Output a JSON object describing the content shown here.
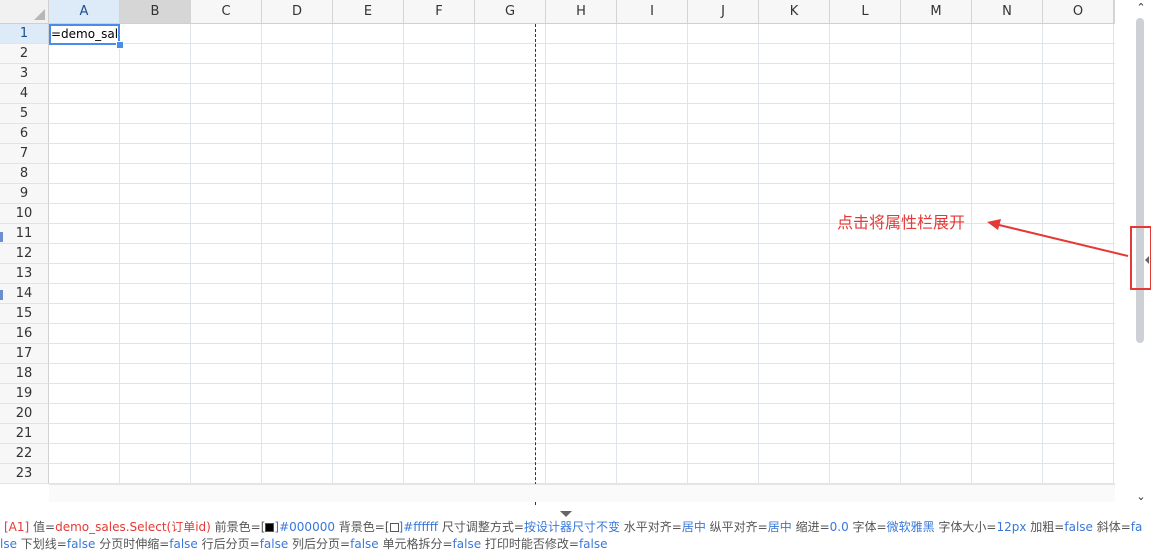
{
  "grid": {
    "columns": [
      "A",
      "B",
      "C",
      "D",
      "E",
      "F",
      "G",
      "H",
      "I",
      "J",
      "K",
      "L",
      "M",
      "N",
      "O"
    ],
    "rows": [
      "1",
      "2",
      "3",
      "4",
      "5",
      "6",
      "7",
      "8",
      "9",
      "10",
      "11",
      "12",
      "13",
      "14",
      "15",
      "16",
      "17",
      "18",
      "19",
      "20",
      "21",
      "22",
      "23"
    ],
    "active_cell": "A1",
    "cells": {
      "A1": "=demo_sale"
    }
  },
  "annotation": {
    "text": "点击将属性栏展开",
    "color": "#e53935"
  },
  "statusbar": {
    "line1": [
      {
        "text": "[A1] ",
        "cls": "s-red"
      },
      {
        "text": "值=",
        "cls": "s-gray"
      },
      {
        "text": "demo_sales.Select(订单id)",
        "cls": "s-red"
      },
      {
        "text": " 前景色=[",
        "cls": "s-gray"
      },
      {
        "swatch": "#000000"
      },
      {
        "text": "]#000000",
        "cls": "s-blue"
      },
      {
        "text": "  背景色=[",
        "cls": "s-gray"
      },
      {
        "swatch": "#ffffff"
      },
      {
        "text": "]#ffffff",
        "cls": "s-blue"
      },
      {
        "text": "  尺寸调整方式=",
        "cls": "s-gray"
      },
      {
        "text": "按设计器尺寸不变",
        "cls": "s-blue"
      },
      {
        "text": "  水平对齐=",
        "cls": "s-gray"
      },
      {
        "text": "居中",
        "cls": "s-blue"
      },
      {
        "text": "  纵平对齐=",
        "cls": "s-gray"
      },
      {
        "text": "居中",
        "cls": "s-blue"
      },
      {
        "text": "  缩进=",
        "cls": "s-gray"
      },
      {
        "text": "0.0",
        "cls": "s-blue"
      },
      {
        "text": "  字体=",
        "cls": "s-gray"
      },
      {
        "text": "微软雅黑",
        "cls": "s-blue"
      },
      {
        "text": "  字体大小=",
        "cls": "s-gray"
      },
      {
        "text": "12px",
        "cls": "s-blue"
      },
      {
        "text": "  加粗=",
        "cls": "s-gray"
      },
      {
        "text": "false",
        "cls": "s-blue"
      },
      {
        "text": "  斜体=",
        "cls": "s-gray"
      },
      {
        "text": "fa",
        "cls": "s-blue"
      }
    ],
    "line2": [
      {
        "text": "lse",
        "cls": "s-blue"
      },
      {
        "text": "  下划线=",
        "cls": "s-gray"
      },
      {
        "text": "false",
        "cls": "s-blue"
      },
      {
        "text": "  分页时伸缩=",
        "cls": "s-gray"
      },
      {
        "text": "false",
        "cls": "s-blue"
      },
      {
        "text": "  行后分页=",
        "cls": "s-gray"
      },
      {
        "text": "false",
        "cls": "s-blue"
      },
      {
        "text": "  列后分页=",
        "cls": "s-gray"
      },
      {
        "text": "false",
        "cls": "s-blue"
      },
      {
        "text": "  单元格拆分=",
        "cls": "s-gray"
      },
      {
        "text": "false",
        "cls": "s-blue"
      },
      {
        "text": "  打印时能否修改=",
        "cls": "s-gray"
      },
      {
        "text": "false",
        "cls": "s-blue"
      }
    ]
  },
  "icons": {
    "scroll_up": "chevron-up-icon",
    "scroll_down": "chevron-down-icon",
    "expand_panel": "chevron-left-icon",
    "collapse_status": "caret-down-icon"
  }
}
